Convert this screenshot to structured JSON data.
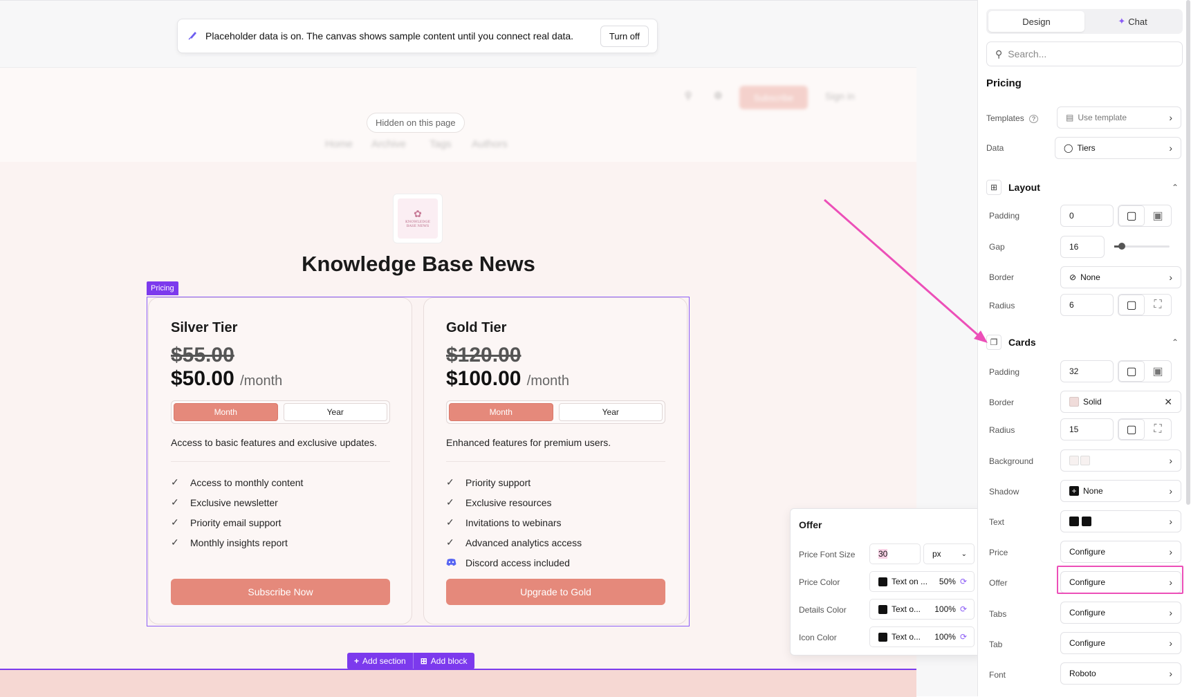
{
  "banner": {
    "icon": "paintbrush-icon",
    "text": "Placeholder data is on. The canvas shows sample content until you connect real data.",
    "button": "Turn off"
  },
  "site_header": {
    "hidden_label": "Hidden on this page",
    "nav": [
      "Home",
      "Archive",
      "Tags",
      "Authors"
    ],
    "subscribe": "Subscribe",
    "sign_in": "Sign in"
  },
  "logo": {
    "line1": "KNOWLEDGE",
    "line2": "BASE NEWS"
  },
  "site_title": "Knowledge Base News",
  "pricing_tag": "Pricing",
  "tiers": [
    {
      "name": "Silver Tier",
      "old_price": "$55.00",
      "price": "$50.00",
      "period": "/month",
      "tab_month": "Month",
      "tab_year": "Year",
      "description": "Access to basic features and exclusive updates.",
      "features": [
        "Access to monthly content",
        "Exclusive newsletter",
        "Priority email support",
        "Monthly insights report"
      ],
      "cta": "Subscribe Now"
    },
    {
      "name": "Gold Tier",
      "old_price": "$120.00",
      "price": "$100.00",
      "period": "/month",
      "tab_month": "Month",
      "tab_year": "Year",
      "description": "Enhanced features for premium users.",
      "features": [
        "Priority support",
        "Exclusive resources",
        "Invitations to webinars",
        "Advanced analytics access",
        "Discord access included"
      ],
      "cta": "Upgrade to Gold"
    }
  ],
  "add_bar": {
    "section": "Add section",
    "block": "Add block"
  },
  "offer_popover": {
    "title": "Offer",
    "price_font_size_label": "Price Font Size",
    "price_font_size_value": "30",
    "unit": "px",
    "price_color_label": "Price Color",
    "price_color_value": "Text on ...",
    "price_color_opacity": "50%",
    "details_color_label": "Details Color",
    "details_color_value": "Text o...",
    "details_color_opacity": "100%",
    "icon_color_label": "Icon Color",
    "icon_color_value": "Text o...",
    "icon_color_opacity": "100%"
  },
  "panel": {
    "tab_design": "Design",
    "tab_chat": "Chat",
    "search_placeholder": "Search...",
    "section_title": "Pricing",
    "templates_label": "Templates",
    "templates_value": "Use template",
    "data_label": "Data",
    "data_value": "Tiers",
    "layout": {
      "title": "Layout",
      "padding_label": "Padding",
      "padding_value": "0",
      "gap_label": "Gap",
      "gap_value": "16",
      "border_label": "Border",
      "border_value": "None",
      "radius_label": "Radius",
      "radius_value": "6"
    },
    "cards": {
      "title": "Cards",
      "padding_label": "Padding",
      "padding_value": "32",
      "border_label": "Border",
      "border_value": "Solid",
      "radius_label": "Radius",
      "radius_value": "15",
      "background_label": "Background",
      "shadow_label": "Shadow",
      "shadow_value": "None",
      "text_label": "Text",
      "price_label": "Price",
      "price_value": "Configure",
      "offer_label": "Offer",
      "offer_value": "Configure",
      "tabs_label": "Tabs",
      "tabs_value": "Configure",
      "tab_label": "Tab",
      "tab_value": "Configure",
      "font_label": "Font",
      "font_value": "Roboto"
    }
  },
  "colors": {
    "accent": "#7c3aed",
    "button": "#e5897b",
    "highlight": "#ec4899"
  }
}
